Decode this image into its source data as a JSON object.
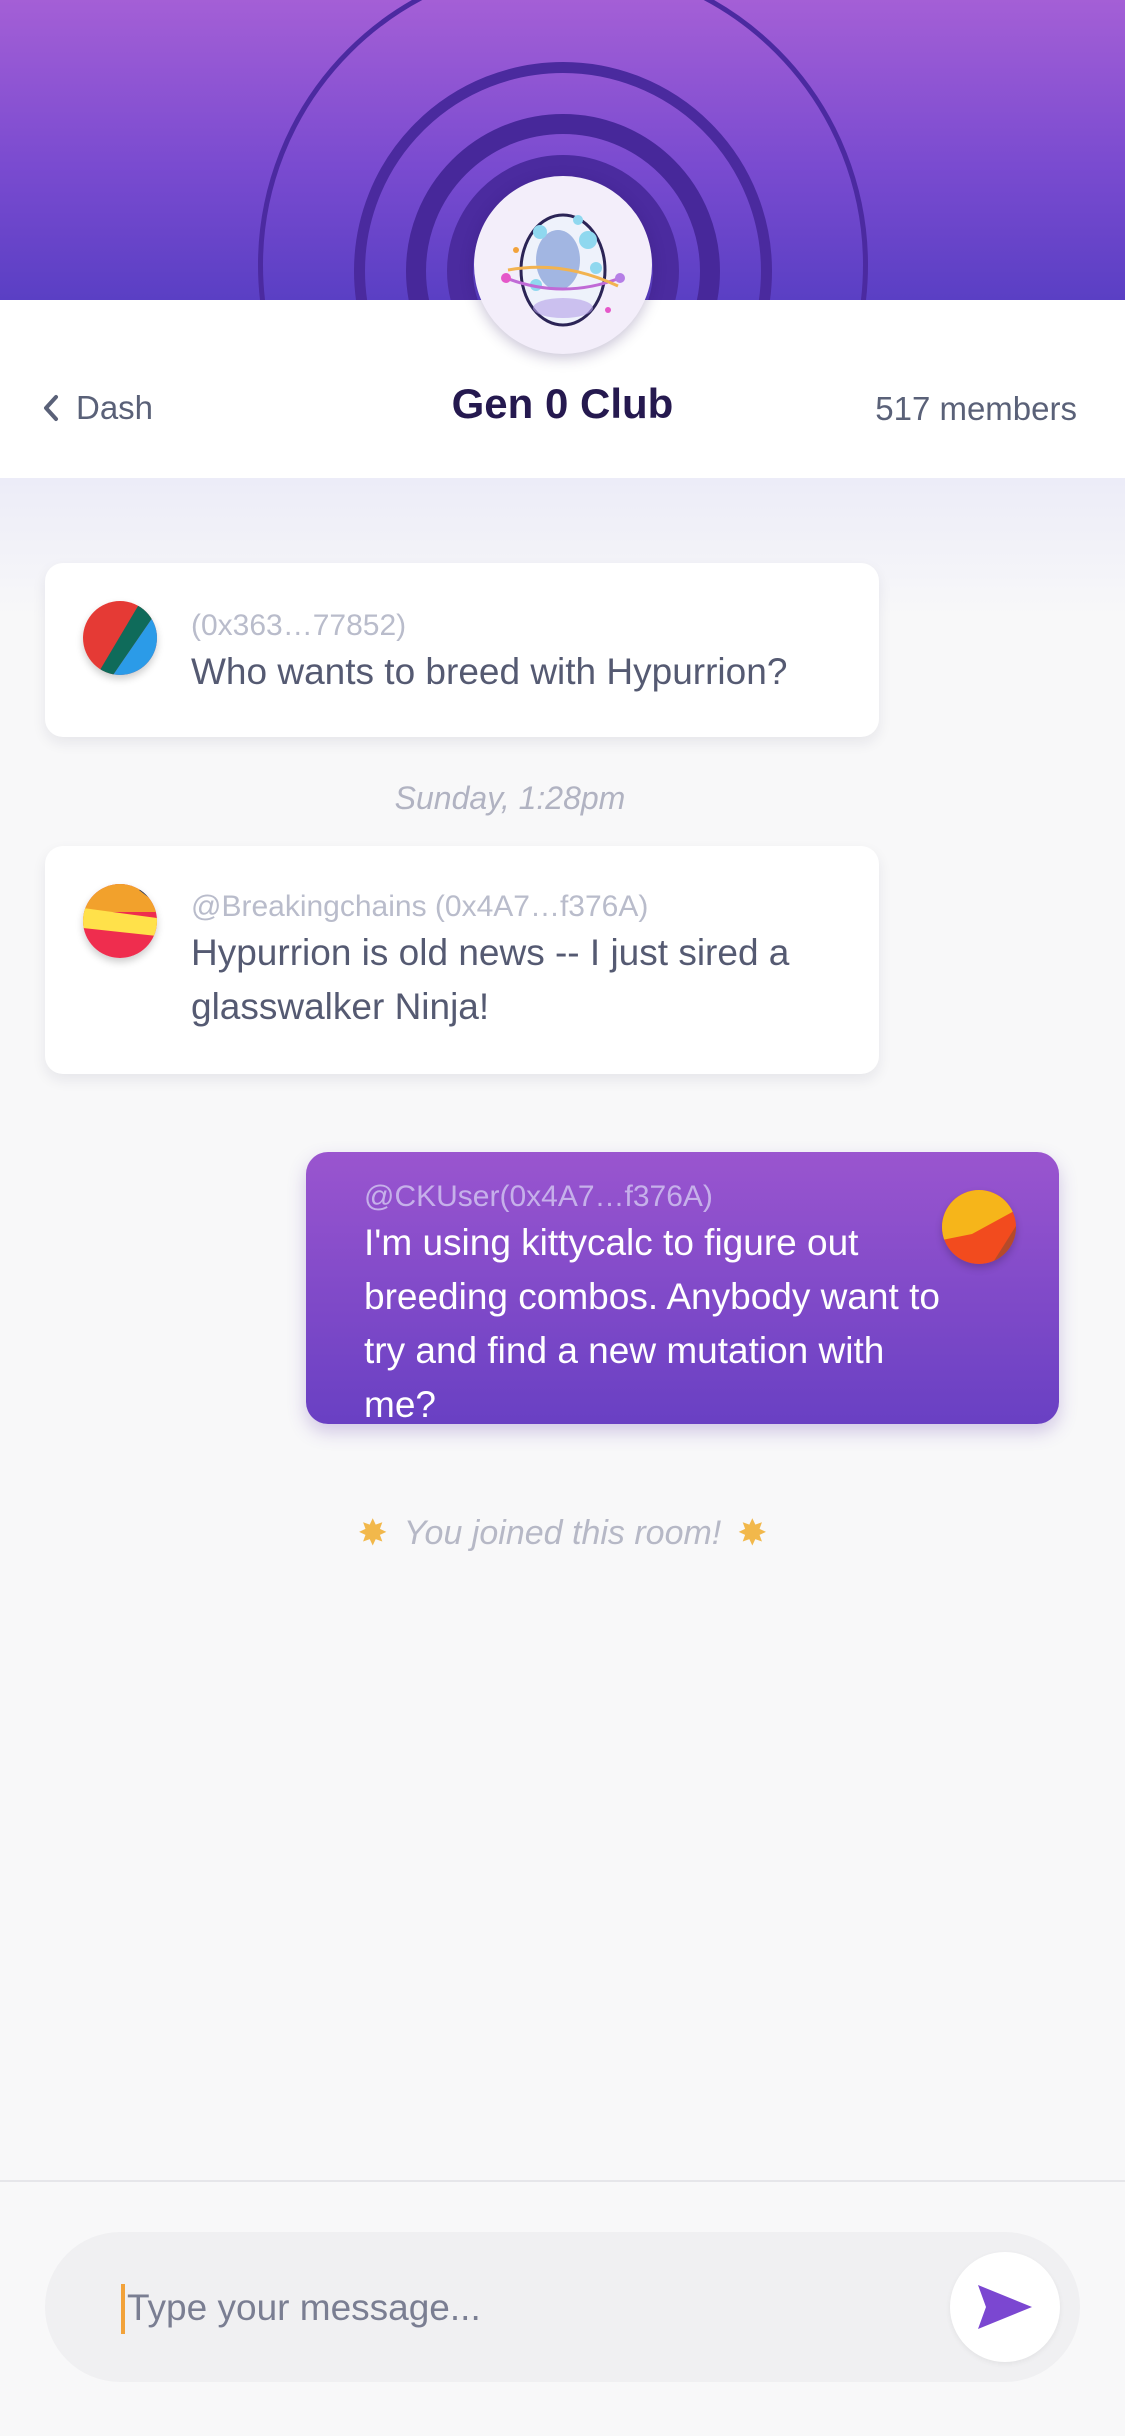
{
  "header": {
    "back_label": "Dash",
    "title": "Gen 0 Club",
    "members": "517 members",
    "room_icon": "egg-icon"
  },
  "messages": [
    {
      "sender": "(0x363…77852)",
      "text": "Who wants to breed with Hypurrion?",
      "avatar_colors": [
        "#e53a35",
        "#0f6b5a",
        "#2b9be8"
      ]
    },
    {
      "sender": "@Breakingchains (0x4A7…f376A)",
      "text": "Hypurrion is old news -- I just sired a glasswalker Ninja!",
      "avatar_colors": [
        "#f2a12c",
        "#ffe14a",
        "#ef2d4e"
      ]
    },
    {
      "sender": "@CKUser(0x4A7…f376A)",
      "text": "I'm using kittycalc to figure out breeding combos.  Anybody want to try and find a new mutation with me?",
      "avatar_colors": [
        "#f6b51a",
        "#f24b1e",
        "#b54a2a"
      ],
      "own": true
    }
  ],
  "timestamp": "Sunday, 1:28pm",
  "joined_notice": {
    "text": "You joined this room!",
    "icon": "sparkle-icon"
  },
  "composer": {
    "placeholder": "Type your message...",
    "value": "",
    "send_icon": "send-icon"
  },
  "colors": {
    "brand_purple": "#7a4bd0",
    "hero_ring": "#4b2aa0",
    "title": "#25194f",
    "caret": "#f2a23a"
  }
}
